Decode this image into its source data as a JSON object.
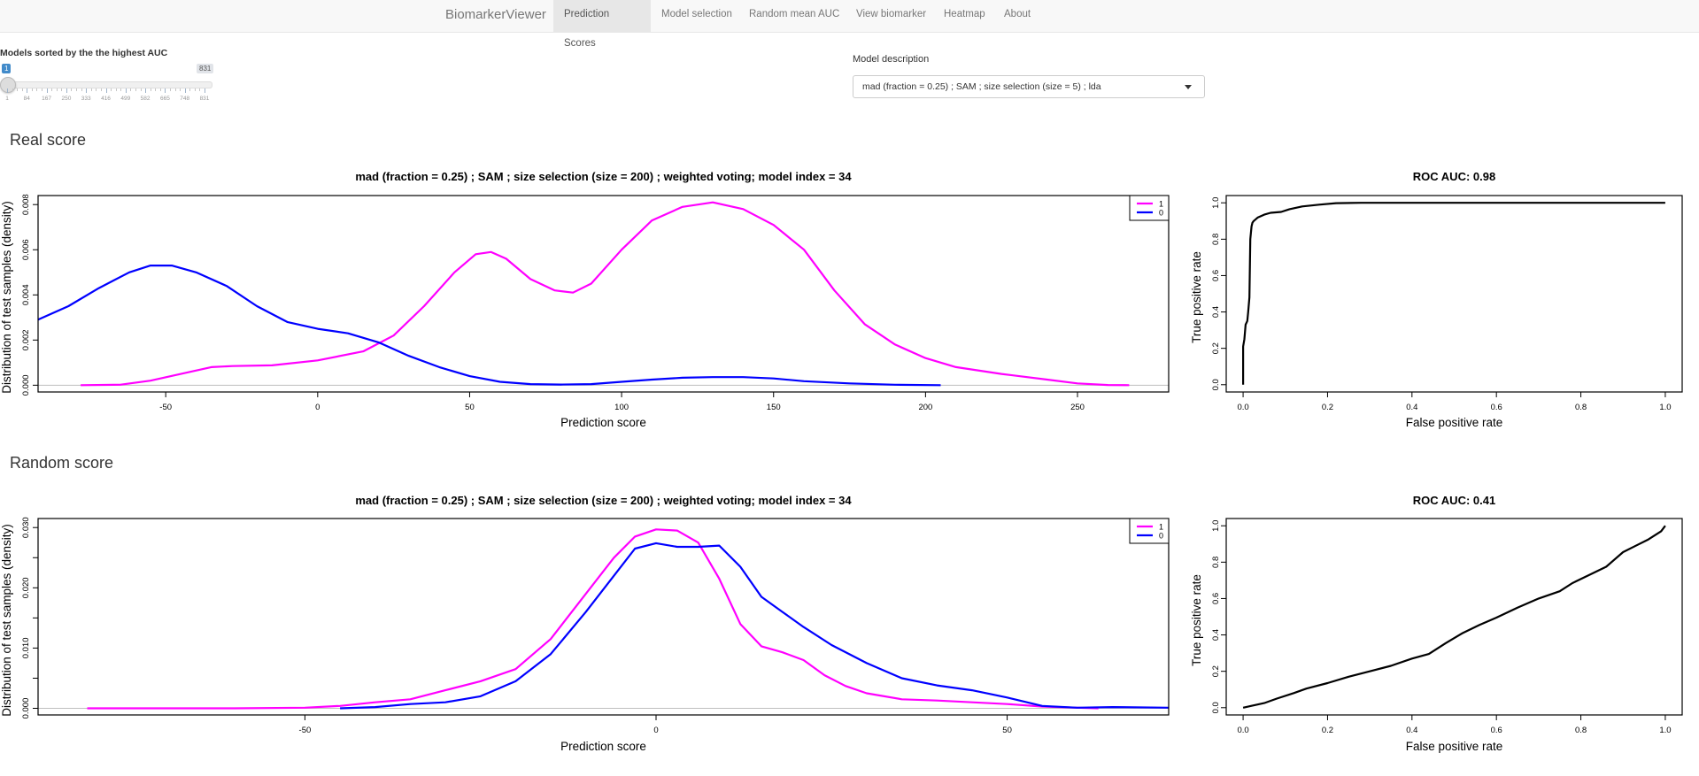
{
  "navbar": {
    "brand": "BiomarkerViewer",
    "items": [
      {
        "label": "Prediction Scores",
        "active": true
      },
      {
        "label": "Model selection",
        "active": false
      },
      {
        "label": "Random mean AUC",
        "active": false
      },
      {
        "label": "View biomarker",
        "active": false
      },
      {
        "label": "Heatmap",
        "active": false
      },
      {
        "label": "About",
        "active": false
      }
    ]
  },
  "slider": {
    "label": "Models sorted by the the highest AUC",
    "value": "1",
    "min": 1,
    "max": "831",
    "tick_labels": [
      "1",
      "84",
      "167",
      "250",
      "333",
      "416",
      "499",
      "582",
      "665",
      "748",
      "831"
    ],
    "accent_color": "#428bca"
  },
  "model_description": {
    "label": "Model description",
    "selected": "mad (fraction = 0.25) ; SAM ; size selection (size = 5) ; lda"
  },
  "sections": {
    "real": "Real score",
    "random": "Random score"
  },
  "chart_data": [
    {
      "id": "real-density",
      "type": "line",
      "title": "mad (fraction = 0.25) ;  SAM ;  size selection (size = 200) ;  weighted voting; model index = 34",
      "xlabel": "Prediction score",
      "ylabel": "Distribution of test samples (density)",
      "xlim": [
        -92,
        280
      ],
      "ylim": [
        -0.0003,
        0.0084
      ],
      "xticks": [
        -50,
        0,
        50,
        100,
        150,
        200,
        250
      ],
      "xtick_labels": [
        "-50",
        "0",
        "50",
        "100",
        "150",
        "200",
        "250"
      ],
      "yticks": [
        0,
        0.002,
        0.004,
        0.006,
        0.008
      ],
      "ytick_labels": [
        "0.000",
        "0.002",
        "0.004",
        "0.006",
        "0.008"
      ],
      "baseline": 0,
      "legend": {
        "position": "top-right",
        "entries": [
          {
            "label": "1",
            "color": "#ff00ff"
          },
          {
            "label": "0",
            "color": "#0000ff"
          }
        ]
      },
      "series": [
        {
          "name": "1",
          "color": "#ff00ff",
          "x": [
            -78,
            -65,
            -55,
            -45,
            -35,
            -28,
            -15,
            0,
            15,
            25,
            35,
            45,
            52,
            57,
            62,
            70,
            78,
            84,
            90,
            100,
            110,
            120,
            130,
            140,
            150,
            160,
            170,
            180,
            190,
            200,
            210,
            225,
            240,
            250,
            260,
            267
          ],
          "y": [
            0,
            2e-05,
            0.0002,
            0.0005,
            0.0008,
            0.00085,
            0.00088,
            0.0011,
            0.0015,
            0.0022,
            0.0035,
            0.005,
            0.0058,
            0.0059,
            0.0056,
            0.0047,
            0.0042,
            0.0041,
            0.0045,
            0.006,
            0.0073,
            0.0079,
            0.0081,
            0.0078,
            0.0071,
            0.006,
            0.0042,
            0.0027,
            0.0018,
            0.0012,
            0.0008,
            0.0005,
            0.00025,
            8e-05,
            1e-05,
            0
          ]
        },
        {
          "name": "0",
          "color": "#0000ff",
          "x": [
            -92,
            -82,
            -72,
            -62,
            -55,
            -48,
            -40,
            -30,
            -20,
            -10,
            0,
            10,
            20,
            30,
            40,
            50,
            60,
            70,
            80,
            90,
            100,
            110,
            120,
            130,
            140,
            150,
            160,
            175,
            190,
            205
          ],
          "y": [
            0.0029,
            0.0035,
            0.0043,
            0.005,
            0.0053,
            0.0053,
            0.005,
            0.0044,
            0.0035,
            0.0028,
            0.0025,
            0.0023,
            0.0019,
            0.0013,
            0.0008,
            0.0004,
            0.00015,
            5e-05,
            3e-05,
            5e-05,
            0.00015,
            0.00025,
            0.00033,
            0.00036,
            0.00036,
            0.0003,
            0.00018,
            8e-05,
            2e-05,
            0
          ]
        }
      ]
    },
    {
      "id": "real-roc",
      "type": "line",
      "title": "ROC AUC: 0.98",
      "xlabel": "False positive rate",
      "ylabel": "True positive rate",
      "xlim": [
        -0.04,
        1.04
      ],
      "ylim": [
        -0.04,
        1.04
      ],
      "xticks": [
        0,
        0.2,
        0.4,
        0.6,
        0.8,
        1
      ],
      "xtick_labels": [
        "0.0",
        "0.2",
        "0.4",
        "0.6",
        "0.8",
        "1.0"
      ],
      "yticks": [
        0,
        0.2,
        0.4,
        0.6,
        0.8,
        1
      ],
      "ytick_labels": [
        "0.0",
        "0.2",
        "0.4",
        "0.6",
        "0.8",
        "1.0"
      ],
      "series": [
        {
          "name": "roc",
          "color": "#000000",
          "x": [
            0,
            0,
            0.003,
            0.006,
            0.01,
            0.012,
            0.015,
            0.017,
            0.02,
            0.022,
            0.025,
            0.035,
            0.05,
            0.065,
            0.09,
            0.11,
            0.14,
            0.18,
            0.22,
            0.28,
            1.0
          ],
          "y": [
            0,
            0.21,
            0.25,
            0.33,
            0.35,
            0.4,
            0.48,
            0.8,
            0.87,
            0.89,
            0.9,
            0.92,
            0.935,
            0.945,
            0.95,
            0.965,
            0.98,
            0.99,
            0.998,
            1.0,
            1.0
          ]
        }
      ]
    },
    {
      "id": "random-density",
      "type": "line",
      "title": "mad (fraction = 0.25) ;  SAM ;  size selection (size = 200) ;  weighted voting; model index = 34",
      "xlabel": "Prediction score",
      "ylabel": "Distribution of test samples (density)",
      "xlim": [
        -88,
        73
      ],
      "ylim": [
        -0.0011,
        0.0315
      ],
      "xticks": [
        -50,
        0,
        50
      ],
      "xtick_labels": [
        "-50",
        "0",
        "50"
      ],
      "yticks": [
        0,
        0.005,
        0.01,
        0.015,
        0.02,
        0.025,
        0.03
      ],
      "ytick_labels": [
        "0.000",
        "",
        "0.010",
        "",
        "0.020",
        "",
        "0.030"
      ],
      "baseline": 0,
      "legend": {
        "position": "top-right",
        "entries": [
          {
            "label": "1",
            "color": "#ff00ff"
          },
          {
            "label": "0",
            "color": "#0000ff"
          }
        ]
      },
      "series": [
        {
          "name": "1",
          "color": "#ff00ff",
          "x": [
            -81,
            -60,
            -50,
            -45,
            -40,
            -35,
            -30,
            -25,
            -20,
            -15,
            -10,
            -6,
            -3,
            0,
            3,
            6,
            9,
            12,
            15,
            18,
            21,
            24,
            27,
            30,
            35,
            40,
            45,
            50,
            55,
            60,
            63
          ],
          "y": [
            0,
            0,
            0.0001,
            0.0004,
            0.001,
            0.0015,
            0.003,
            0.0045,
            0.0065,
            0.0115,
            0.019,
            0.025,
            0.0285,
            0.0297,
            0.0295,
            0.0275,
            0.0215,
            0.014,
            0.0103,
            0.0093,
            0.008,
            0.0055,
            0.0037,
            0.0025,
            0.0015,
            0.0013,
            0.001,
            0.0007,
            0.0003,
            0.0001,
            0
          ]
        },
        {
          "name": "0",
          "color": "#0000ff",
          "x": [
            -45,
            -40,
            -35,
            -30,
            -25,
            -20,
            -15,
            -10,
            -6,
            -3,
            0,
            3,
            6,
            9,
            12,
            15,
            18,
            21,
            25,
            30,
            35,
            40,
            45,
            50,
            55,
            60,
            65,
            73
          ],
          "y": [
            0,
            0.0002,
            0.0007,
            0.001,
            0.002,
            0.0045,
            0.009,
            0.016,
            0.022,
            0.0265,
            0.0274,
            0.0268,
            0.0268,
            0.027,
            0.0235,
            0.0185,
            0.016,
            0.0135,
            0.0105,
            0.0075,
            0.005,
            0.0038,
            0.003,
            0.0018,
            0.0004,
            0.0001,
            0.0002,
            0.0001
          ]
        }
      ]
    },
    {
      "id": "random-roc",
      "type": "line",
      "title": "ROC AUC: 0.41",
      "xlabel": "False positive rate",
      "ylabel": "True positive rate",
      "xlim": [
        -0.04,
        1.04
      ],
      "ylim": [
        -0.04,
        1.04
      ],
      "xticks": [
        0,
        0.2,
        0.4,
        0.6,
        0.8,
        1
      ],
      "xtick_labels": [
        "0.0",
        "0.2",
        "0.4",
        "0.6",
        "0.8",
        "1.0"
      ],
      "yticks": [
        0,
        0.2,
        0.4,
        0.6,
        0.8,
        1
      ],
      "ytick_labels": [
        "0.0",
        "0.2",
        "0.4",
        "0.6",
        "0.8",
        "1.0"
      ],
      "series": [
        {
          "name": "roc",
          "color": "#000000",
          "x": [
            0,
            0.02,
            0.05,
            0.08,
            0.12,
            0.15,
            0.2,
            0.25,
            0.3,
            0.35,
            0.4,
            0.44,
            0.48,
            0.52,
            0.56,
            0.6,
            0.65,
            0.7,
            0.75,
            0.78,
            0.82,
            0.86,
            0.9,
            0.93,
            0.96,
            0.99,
            1.0
          ],
          "y": [
            0,
            0.01,
            0.025,
            0.05,
            0.08,
            0.105,
            0.135,
            0.17,
            0.2,
            0.23,
            0.27,
            0.295,
            0.355,
            0.41,
            0.455,
            0.495,
            0.55,
            0.6,
            0.64,
            0.685,
            0.73,
            0.775,
            0.855,
            0.89,
            0.925,
            0.97,
            1.0
          ]
        }
      ]
    }
  ]
}
